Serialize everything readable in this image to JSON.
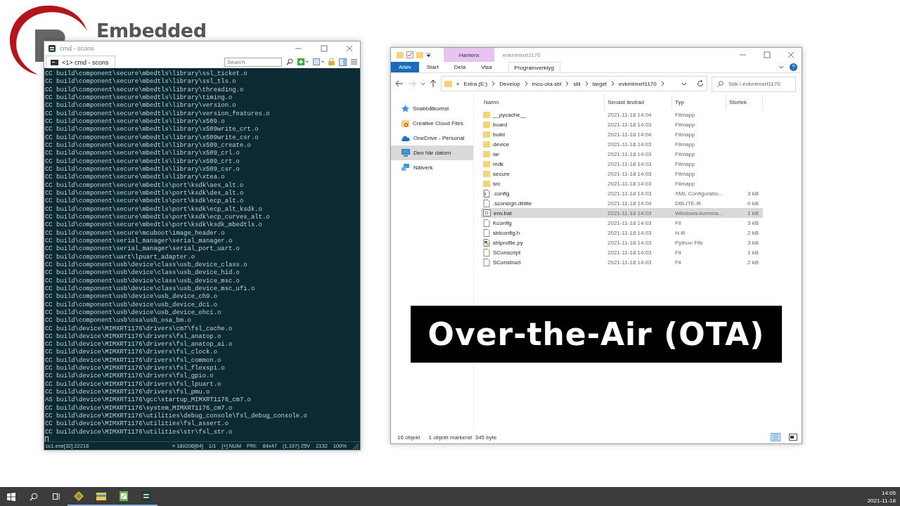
{
  "logo": {
    "text": "Embedded"
  },
  "terminal": {
    "title": "cmd - scons",
    "tab": "<1> cmd - scons",
    "search": {
      "placeholder": "Search"
    },
    "lines": [
      "CC build\\component\\secure\\mbedtls\\library\\ssl_ticket.o",
      "CC build\\component\\secure\\mbedtls\\library\\ssl_tls.o",
      "CC build\\component\\secure\\mbedtls\\library\\threading.o",
      "CC build\\component\\secure\\mbedtls\\library\\timing.o",
      "CC build\\component\\secure\\mbedtls\\library\\version.o",
      "CC build\\component\\secure\\mbedtls\\library\\version_features.o",
      "CC build\\component\\secure\\mbedtls\\library\\x509.o",
      "CC build\\component\\secure\\mbedtls\\library\\x509write_crt.o",
      "CC build\\component\\secure\\mbedtls\\library\\x509write_csr.o",
      "CC build\\component\\secure\\mbedtls\\library\\x509_create.o",
      "CC build\\component\\secure\\mbedtls\\library\\x509_crl.o",
      "CC build\\component\\secure\\mbedtls\\library\\x509_crt.o",
      "CC build\\component\\secure\\mbedtls\\library\\x509_csr.o",
      "CC build\\component\\secure\\mbedtls\\library\\xtea.o",
      "CC build\\component\\secure\\mbedtls\\port\\ksdk\\aes_alt.o",
      "CC build\\component\\secure\\mbedtls\\port\\ksdk\\des_alt.o",
      "CC build\\component\\secure\\mbedtls\\port\\ksdk\\ecp_alt.o",
      "CC build\\component\\secure\\mbedtls\\port\\ksdk\\ecp_alt_ksdk.o",
      "CC build\\component\\secure\\mbedtls\\port\\ksdk\\ecp_curves_alt.o",
      "CC build\\component\\secure\\mbedtls\\port\\ksdk\\ksdk_mbedtls.o",
      "CC build\\component\\secure\\mcuboot\\image_header.o",
      "CC build\\component\\serial_manager\\serial_manager.o",
      "CC build\\component\\serial_manager\\serial_port_uart.o",
      "CC build\\component\\uart\\lpuart_adapter.o",
      "CC build\\component\\usb\\device\\class\\usb_device_class.o",
      "CC build\\component\\usb\\device\\class\\usb_device_hid.o",
      "CC build\\component\\usb\\device\\class\\usb_device_msc.o",
      "CC build\\component\\usb\\device\\class\\usb_device_msc_ufi.o",
      "CC build\\component\\usb\\device\\usb_device_ch9.o",
      "CC build\\component\\usb\\device\\usb_device_dci.o",
      "CC build\\component\\usb\\device\\usb_device_ehci.o",
      "CC build\\component\\usb\\osa\\usb_osa_bm.o",
      "CC build\\device\\MIMXRT1176\\drivers\\cm7\\fsl_cache.o",
      "CC build\\device\\MIMXRT1176\\drivers\\fsl_anatop.o",
      "CC build\\device\\MIMXRT1176\\drivers\\fsl_anatop_ai.o",
      "CC build\\device\\MIMXRT1176\\drivers\\fsl_clock.o",
      "CC build\\device\\MIMXRT1176\\drivers\\fsl_common.o",
      "CC build\\device\\MIMXRT1176\\drivers\\fsl_flexspi.o",
      "CC build\\device\\MIMXRT1176\\drivers\\fsl_gpio.o",
      "CC build\\device\\MIMXRT1176\\drivers\\fsl_lpuart.o",
      "CC build\\device\\MIMXRT1176\\drivers\\fsl_pmu.o",
      "AS build\\device\\MIMXRT1176\\gcc\\startup_MIMXRT1176_cm7.o",
      "CC build\\device\\MIMXRT1176\\system_MIMXRT1176_cm7.o",
      "CC build\\device\\MIMXRT1176\\utilities\\debug_console\\fsl_debug_console.o",
      "CC build\\device\\MIMXRT1176\\utilities\\fsl_assert.o",
      "CC build\\device\\MIMXRT1176\\utilities\\str\\fsl_str.o"
    ],
    "status_bar": [
      "cc1.exe[32]:22216",
      "« 180206[64]",
      "1/1",
      "[+] NUM",
      "PRI:",
      "84x47",
      "(1,197) 25V",
      "2132",
      "100%"
    ]
  },
  "explorer": {
    "title": "evkmimxrt1170",
    "context_label": "Hantera",
    "ribbon_tabs": [
      {
        "label": "Arkiv",
        "kind": "file"
      },
      {
        "label": "Start",
        "kind": "tab"
      },
      {
        "label": "Dela",
        "kind": "tab"
      },
      {
        "label": "Visa",
        "kind": "tab"
      },
      {
        "label": "Programverktyg",
        "kind": "contextual"
      }
    ],
    "breadcrumbs": [
      "«",
      "Extra (E:)",
      "Develop",
      "mcu-ota-sbl",
      "sbl",
      "target",
      "evkmimxrt1170"
    ],
    "search": {
      "placeholder": "Sök i evkmimxrt1170"
    },
    "nav": [
      {
        "label": "Snabbåtkomst",
        "kind": "star",
        "selected": false
      },
      {
        "label": "Creative Cloud Files",
        "kind": "cloudfolder",
        "selected": false
      },
      {
        "label": "OneDrive - Personal",
        "kind": "cloud",
        "selected": false
      },
      {
        "label": "Den här datorn",
        "kind": "pc",
        "selected": true
      },
      {
        "label": "Nätverk",
        "kind": "network",
        "selected": false
      }
    ],
    "columns": [
      "Namn",
      "Senast ändrad",
      "Typ",
      "Storlek"
    ],
    "rows": [
      {
        "name": "__pycache__",
        "date": "2021-11-18 14:04",
        "type": "Filmapp",
        "kind": "folder",
        "selected": false
      },
      {
        "name": "board",
        "date": "2021-11-18 14:03",
        "type": "Filmapp",
        "kind": "folder",
        "selected": false
      },
      {
        "name": "build",
        "date": "2021-11-18 14:04",
        "type": "Filmapp",
        "kind": "folder",
        "selected": false
      },
      {
        "name": "device",
        "date": "2021-11-18 14:03",
        "type": "Filmapp",
        "kind": "folder",
        "selected": false
      },
      {
        "name": "iar",
        "date": "2021-11-18 14:03",
        "type": "Filmapp",
        "kind": "folder",
        "selected": false
      },
      {
        "name": "mdk",
        "date": "2021-11-18 14:03",
        "type": "Filmapp",
        "kind": "folder",
        "selected": false
      },
      {
        "name": "secure",
        "date": "2021-11-18 14:03",
        "type": "Filmapp",
        "kind": "folder",
        "selected": false
      },
      {
        "name": "src",
        "date": "2021-11-18 14:03",
        "type": "Filmapp",
        "kind": "folder",
        "selected": false
      },
      {
        "name": ".config",
        "date": "2021-11-18 14:03",
        "type": "XML Configuratio...",
        "size": "3 kB",
        "kind": "xml",
        "selected": false
      },
      {
        "name": ".sconsign.dblite",
        "date": "2021-11-18 14:04",
        "type": "DBLITE-fil",
        "size": "0 kB",
        "kind": "file",
        "selected": false
      },
      {
        "name": "env.bat",
        "date": "2021-11-18 14:03",
        "type": "Windows-komma...",
        "size": "1 kB",
        "kind": "bat",
        "selected": true
      },
      {
        "name": "Kconfig",
        "date": "2021-11-18 14:03",
        "type": "Fil",
        "size": "3 kB",
        "kind": "file",
        "selected": false
      },
      {
        "name": "sblconfig.h",
        "date": "2021-11-18 14:03",
        "type": "H-fil",
        "size": "2 kB",
        "kind": "file",
        "selected": false
      },
      {
        "name": "sblprofile.py",
        "date": "2021-11-18 14:03",
        "type": "Python File",
        "size": "3 kB",
        "kind": "python",
        "selected": false
      },
      {
        "name": "SConscript",
        "date": "2021-11-18 14:03",
        "type": "Fil",
        "size": "1 kB",
        "kind": "file",
        "selected": false
      },
      {
        "name": "SConstruct",
        "date": "2021-11-18 14:03",
        "type": "Fil",
        "size": "2 kB",
        "kind": "file",
        "selected": false
      }
    ],
    "status_bar": [
      "16 objekt",
      "1 objekt markerat  345 byte"
    ]
  },
  "caption": "Over-the-Air (OTA)",
  "taskbar": {
    "time": "14:05",
    "date": "2021-11-18"
  }
}
